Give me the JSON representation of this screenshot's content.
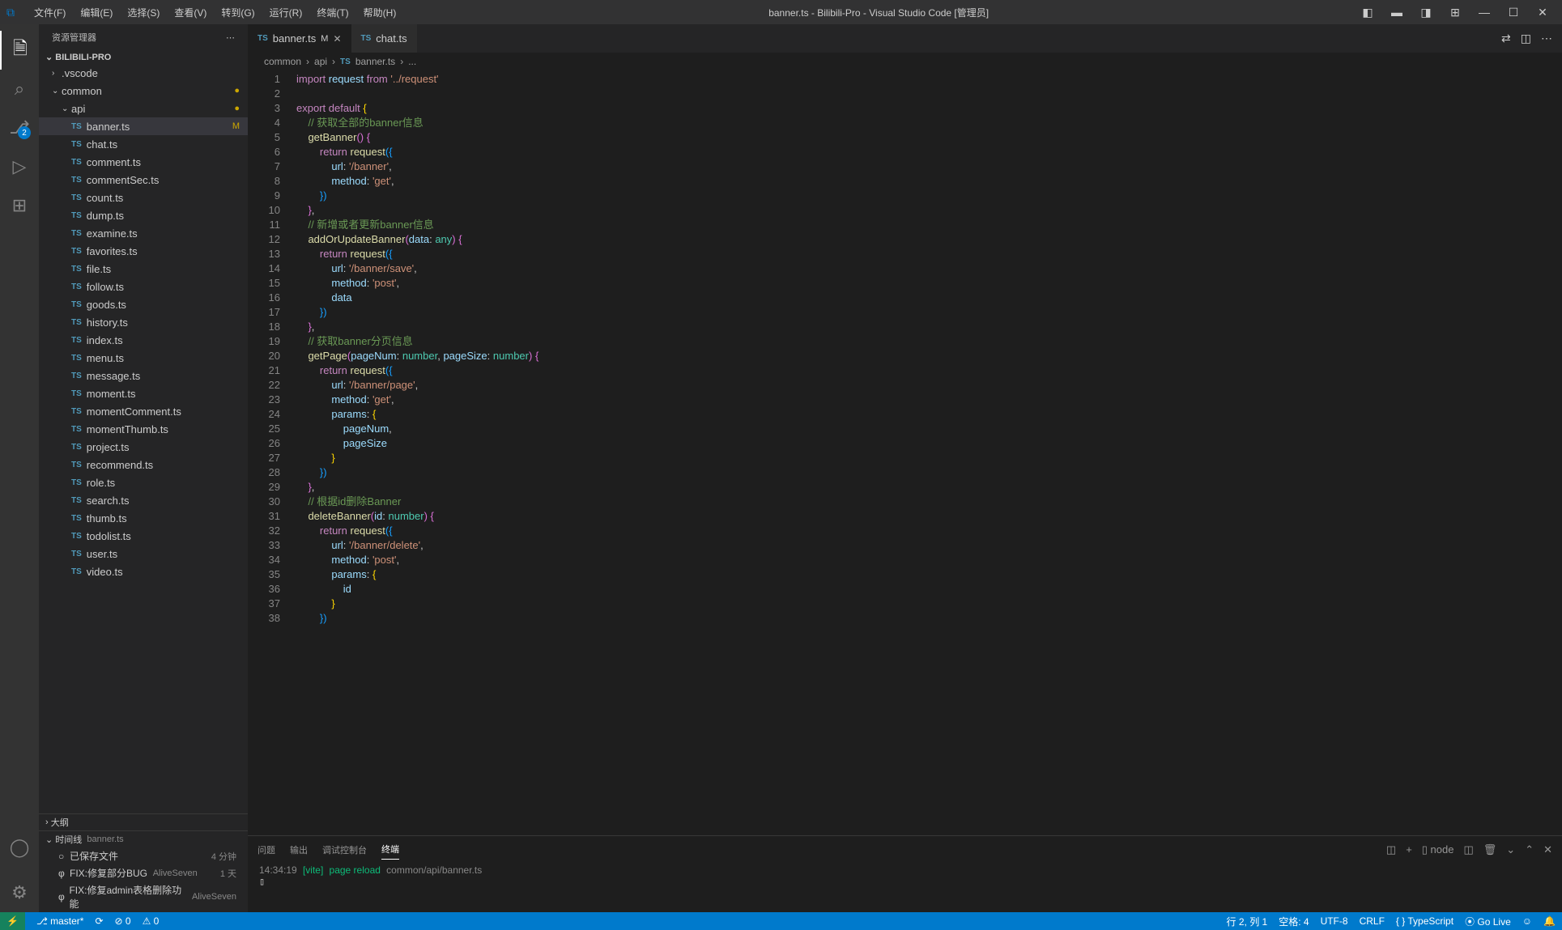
{
  "title": "banner.ts - Bilibili-Pro - Visual Studio Code [管理员]",
  "menu": [
    "文件(F)",
    "编辑(E)",
    "选择(S)",
    "查看(V)",
    "转到(G)",
    "运行(R)",
    "终端(T)",
    "帮助(H)"
  ],
  "sidebar": {
    "header": "资源管理器",
    "project": "BILIBILI-PRO",
    "folders": {
      "vscode": ".vscode",
      "common": "common",
      "api": "api"
    },
    "files": [
      "banner.ts",
      "chat.ts",
      "comment.ts",
      "commentSec.ts",
      "count.ts",
      "dump.ts",
      "examine.ts",
      "favorites.ts",
      "file.ts",
      "follow.ts",
      "goods.ts",
      "history.ts",
      "index.ts",
      "menu.ts",
      "message.ts",
      "moment.ts",
      "momentComment.ts",
      "momentThumb.ts",
      "project.ts",
      "recommend.ts",
      "role.ts",
      "search.ts",
      "thumb.ts",
      "todolist.ts",
      "user.ts",
      "video.ts"
    ],
    "outline": "大纲",
    "timeline_title": "时间线",
    "timeline_file": "banner.ts",
    "timeline": [
      {
        "icon": "○",
        "label": "已保存文件",
        "meta": "4 分钟"
      },
      {
        "icon": "φ",
        "label": "FIX:修复部分BUG",
        "author": "AliveSeven",
        "meta": "1 天"
      },
      {
        "icon": "φ",
        "label": "FIX:修复admin表格删除功能",
        "author": "AliveSeven",
        "meta": ""
      }
    ],
    "file_status": {
      "banner.ts": "M"
    }
  },
  "tabs": [
    {
      "name": "banner.ts",
      "modified": true,
      "active": true
    },
    {
      "name": "chat.ts",
      "modified": false,
      "active": false
    }
  ],
  "breadcrumbs": [
    "common",
    "api",
    "banner.ts",
    "..."
  ],
  "code_lines": 38,
  "panel": {
    "tabs": [
      "问题",
      "输出",
      "调试控制台",
      "终端"
    ],
    "active": "终端",
    "shell": "node",
    "output_time": "14:34:19",
    "output_tag": "[vite]",
    "output_msg": "page reload",
    "output_path": "common/api/banner.ts"
  },
  "status": {
    "branch": "master*",
    "sync": "⟳",
    "errors": "⊘ 0",
    "warnings": "⚠ 0",
    "ln": "行 2, 列 1",
    "spaces": "空格: 4",
    "encoding": "UTF-8",
    "eol": "CRLF",
    "lang": "TypeScript",
    "golive": "⦿ Go Live"
  },
  "scm_badge": "2"
}
